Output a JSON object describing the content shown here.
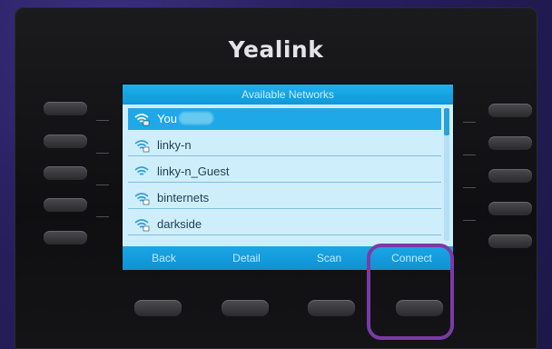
{
  "device": {
    "brand": "Yealink"
  },
  "screen": {
    "title": "Available Networks",
    "networks": [
      {
        "ssid": "You",
        "secured": true,
        "selected": true
      },
      {
        "ssid": "linky-n",
        "secured": true,
        "selected": false
      },
      {
        "ssid": "linky-n_Guest",
        "secured": false,
        "selected": false
      },
      {
        "ssid": "binternets",
        "secured": true,
        "selected": false
      },
      {
        "ssid": "darkside",
        "secured": true,
        "selected": false
      }
    ],
    "softkeys": [
      "Back",
      "Detail",
      "Scan",
      "Connect"
    ]
  },
  "colors": {
    "screen_accent": "#1fa8e8",
    "highlight": "#7b3aa6"
  }
}
